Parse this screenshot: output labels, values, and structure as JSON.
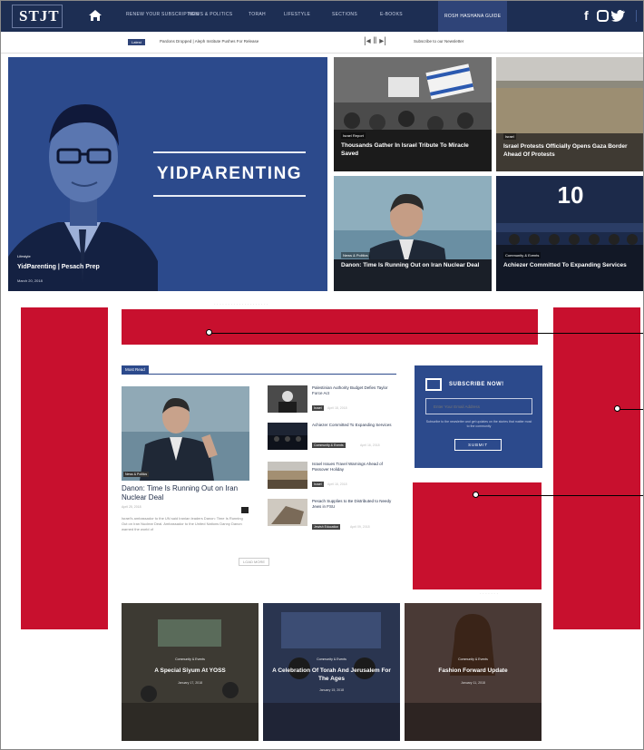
{
  "brand": {
    "logo": "STJT"
  },
  "nav": {
    "items": [
      "Renew Your Subscription",
      "News & Politics",
      "Torah",
      "Lifestyle",
      "Sections",
      "E-Books",
      "Rosh Hashana Guide"
    ]
  },
  "ticker": {
    "badge": "Latest",
    "text": "Pardons Dropped | Aleph Institute Pushes For Release",
    "controls": "|◂ ‖ ▸|",
    "right_text": "Subscribe to our Newsletter"
  },
  "hero": {
    "word": "YIDPARENTING",
    "tag": "Lifestyle",
    "headline": "YidParenting | Pesach Prep",
    "date": "March 20, 2018"
  },
  "tiles": [
    {
      "category": "Israel Report",
      "title": "Thousands Gather In Israel Tribute To Miracle Saved"
    },
    {
      "category": "Israel",
      "title": "Israel Protests Officially Opens Gaza Border Ahead Of Protests"
    },
    {
      "category": "News & Politics",
      "title": "Danon: Time Is Running Out on Iran Nuclear Deal"
    },
    {
      "category": "Community & Events",
      "title": "Achiezer Committed To Expanding Services"
    }
  ],
  "most_read": {
    "tab": "Most Read",
    "main": {
      "category": "News & Politics",
      "title": "Danon: Time Is Running Out on Iran Nuclear Deal",
      "date": "April 25, 2018",
      "excerpt": "Israel's ambassador to the UN said Iranian leaders Danon: Time Is Running Out on Iran Nuclear Deal. Ambassador to the United Nations Danny Danon warned the world of"
    },
    "items": [
      {
        "title": "Palestinian Authority Budget Defies Taylor Force Act",
        "badge": "Israel",
        "date": "April 18, 2018"
      },
      {
        "title": "Achiezer Committed To Expanding Services",
        "badge": "Community & Events",
        "date": "April 16, 2018"
      },
      {
        "title": "Israel Issues Travel Warnings Ahead of Passover Holiday",
        "badge": "Israel",
        "date": "April 16, 2018"
      },
      {
        "title": "Pesach Supplies to Be Distributed to Needy Jews in FSU",
        "badge": "Jewish Education",
        "date": "April 09, 2018"
      }
    ],
    "more": "LOAD MORE"
  },
  "subscribe": {
    "title": "SUBSCRIBE NOW!",
    "placeholder": "Enter Your Email Address",
    "note": "Subscribe to the newsletter and get updates on the stories that matter most to the community",
    "button": "SUBMIT"
  },
  "bottom_tiles": [
    {
      "category": "Community & Events",
      "title": "A Special Siyum At YOSS",
      "date": "January 17, 2018"
    },
    {
      "category": "Community & Events",
      "title": "A Celebration Of Torah And Jerusalem For The Ages",
      "date": "January 15, 2018"
    },
    {
      "category": "Community & Events",
      "title": "Fashion Forward Update",
      "date": "January 11, 2018"
    }
  ],
  "colors": {
    "navy": "#1d2e53",
    "brand_blue": "#2c4a8c",
    "ad_red": "#c8102e"
  }
}
